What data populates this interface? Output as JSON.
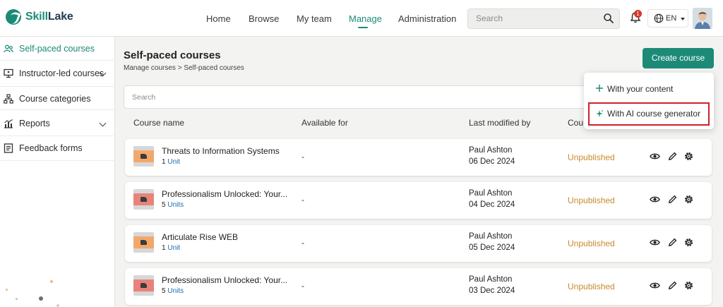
{
  "app": {
    "brand_part1": "Skill",
    "brand_part2": "Lake"
  },
  "nav": {
    "items": [
      "Home",
      "Browse",
      "My team",
      "Manage",
      "Administration"
    ],
    "active": "Manage"
  },
  "header": {
    "search_placeholder": "Search",
    "notifications_count": "1",
    "language": "EN"
  },
  "sidebar": {
    "items": [
      {
        "label": "Self-paced courses",
        "icon": "people-icon",
        "active": true
      },
      {
        "label": "Instructor-led courses",
        "icon": "presentation-icon",
        "chevron": true
      },
      {
        "label": "Course categories",
        "icon": "hierarchy-icon"
      },
      {
        "label": "Reports",
        "icon": "chart-icon",
        "chevron": true
      },
      {
        "label": "Feedback forms",
        "icon": "form-icon"
      }
    ]
  },
  "page": {
    "title": "Self-paced courses",
    "breadcrumb": "Manage courses  >  Self-paced courses",
    "create_button": "Create course",
    "search_placeholder": "Search"
  },
  "table": {
    "headers": [
      "Course name",
      "Available for",
      "Last modified by",
      "Cou"
    ],
    "rows": [
      {
        "name": "Threats to Information Systems",
        "units_count": "1",
        "units_label": "Unit",
        "available": "-",
        "modified_by": "Paul Ashton",
        "date": "06 Dec 2024",
        "status": "Unpublished",
        "thumb_color": "#f2a86b"
      },
      {
        "name": "Professionalism Unlocked: Your...",
        "units_count": "5",
        "units_label": "Units",
        "available": "-",
        "modified_by": "Paul Ashton",
        "date": "04 Dec 2024",
        "status": "Unpublished",
        "thumb_color": "#e8837a"
      },
      {
        "name": "Articulate Rise WEB",
        "units_count": "1",
        "units_label": "Unit",
        "available": "-",
        "modified_by": "Paul Ashton",
        "date": "05 Dec 2024",
        "status": "Unpublished",
        "thumb_color": "#f2a86b"
      },
      {
        "name": "Professionalism Unlocked: Your...",
        "units_count": "5",
        "units_label": "Units",
        "available": "-",
        "modified_by": "Paul Ashton",
        "date": "03 Dec 2024",
        "status": "Unpublished",
        "thumb_color": "#e8837a"
      }
    ]
  },
  "create_menu": {
    "items": [
      {
        "label": "With your content",
        "icon": "plus-icon"
      },
      {
        "label": "With AI course generator",
        "icon": "sparkle-icon",
        "highlighted": true
      }
    ]
  },
  "colors": {
    "accent": "#1d8a78",
    "status_unpublished": "#c78b2d",
    "highlight_border": "#d0202a"
  }
}
